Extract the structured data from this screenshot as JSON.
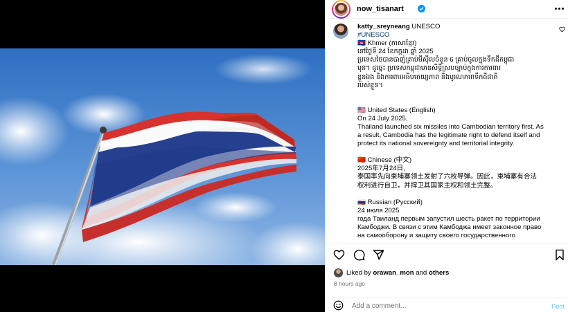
{
  "post": {
    "author": "now_tisanart",
    "image_alt": "Thai flag waving against a blue sky with clouds"
  },
  "comment": {
    "username": "katty_sreyneang",
    "name_suffix": "UNESCO",
    "hashtag": "#UNESCO",
    "lines": [
      "🇰🇭 Khmer (ភាសាខ្មែរ)",
      "នៅថ្ងៃទី 24 ខែកក្កដា ឆ្នាំ 2025",
      "ប្រទេសថៃបានបាញ់គ្រាប់មីស៊ីលចំនួន 6 គ្រាប់ចូលក្នុងទឹកដីកម្ពុជា",
      "មុន។ ដូច្នេះ ប្រទេសកម្ពុជាមានសិទ្ធិស្របច្បាប់ក្នុងការការពារ",
      "ខ្លួនឯង និងការពារអធិបតេយ្យភាព និងបូរណភាពទឹកដីជាតិ",
      "របស់ខ្លួន។",
      "",
      "🇺🇸 United States (English)",
      "On 24 July 2025,",
      "Thailand launched six missiles into Cambodian territory first. As",
      "a result, Cambodia has the legitimate right to defend itself and",
      "protect its national sovereignty and territorial integrity.",
      "",
      "🇨🇳 Chinese (中文)",
      "2025年7月24日,",
      "泰国率先向柬埔寨领土发射了六枚导弹。因此，柬埔寨有合法",
      "权利进行自卫，并捍卫其国家主权和领土完整。",
      "",
      "🇷🇺 Russian (Русский)",
      "24 июля 2025",
      "года Таиланд первым запустил шесть ракет по территории",
      "Камбоджи. В связи с этим Камбоджа имеет законное право",
      "на самооборону и защиту своего государственного"
    ]
  },
  "likes": {
    "prefix": "Liked by",
    "user": "orawan_mon",
    "and": "and",
    "others": "others"
  },
  "timestamp": "8 hours ago",
  "add_comment": {
    "placeholder": "Add a comment...",
    "post_label": "Post"
  }
}
